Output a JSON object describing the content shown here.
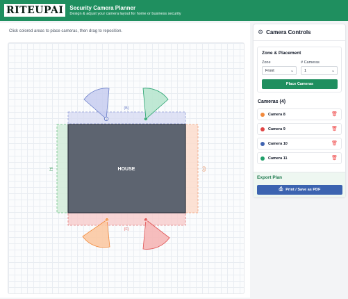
{
  "header": {
    "logo": "RITEUPAI",
    "title": "Security Camera Planner",
    "subtitle": "Design & adjust your camera layout for home or business security"
  },
  "instruction": "Click colored areas to place cameras, then drag to reposition.",
  "canvas": {
    "house_label": "HOUSE",
    "zone_labels": {
      "back": "(B)",
      "front": "(F)",
      "left": "(L)",
      "right": "(R)"
    },
    "cameras": [
      {
        "id": "2",
        "color": "#6b7fc9",
        "fill": "#c7cdf0"
      },
      {
        "id": "1",
        "color": "#22a06b",
        "fill": "#b8e6cf"
      },
      {
        "id": "3",
        "color": "#f28a3c",
        "fill": "#fbc9a3"
      },
      {
        "id": "4",
        "color": "#e05252",
        "fill": "#f5b6b6"
      }
    ]
  },
  "controls": {
    "title": "Camera Controls",
    "zone_section_title": "Zone & Placement",
    "zone_label": "Zone",
    "zone_value": "Front",
    "num_label": "# Cameras",
    "num_value": "1",
    "place_button": "Place Cameras",
    "cameras_title": "Cameras (4)",
    "cameras": [
      {
        "name": "Camera 8",
        "color": "#f28a3c"
      },
      {
        "name": "Camera 9",
        "color": "#e04545"
      },
      {
        "name": "Camera 10",
        "color": "#3f63b0"
      },
      {
        "name": "Camera 11",
        "color": "#22a06b"
      }
    ],
    "export_title": "Export Plan",
    "print_button": "Print / Save as PDF"
  }
}
